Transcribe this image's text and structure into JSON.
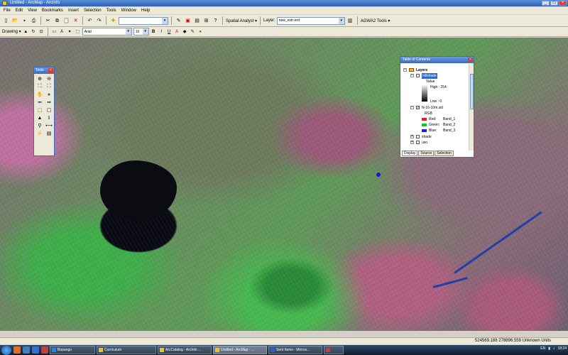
{
  "window": {
    "title": "Untitled - ArcMap - ArcInfo"
  },
  "menu": [
    "File",
    "Edit",
    "View",
    "Bookmarks",
    "Insert",
    "Selection",
    "Tools",
    "Window",
    "Help"
  ],
  "toolbar1": {
    "spatial_analyst_label": "Spatial Analyst ▾",
    "layer_label": "Layer:",
    "layer_value": "new_extr-erd",
    "agwa_label": "AGWA2 Tools ▾"
  },
  "toolbar2": {
    "drawing_label": "Drawing ▾",
    "font_name": "Arial",
    "font_size": "10",
    "bold": "B",
    "italic": "I",
    "underline": "U",
    "font_color": "A"
  },
  "tools_window": {
    "title": "Tools"
  },
  "toc": {
    "title": "Table of Contents",
    "root": "Layers",
    "layers": [
      {
        "name": "hillshade",
        "checked": false,
        "selected": true
      },
      {
        "legend_title": "Value"
      },
      {
        "high": "High : 254"
      },
      {
        "low": "Low : 0"
      },
      {
        "name": "N-16-10m.sid",
        "checked": true
      },
      {
        "legend_title": "RGB"
      },
      {
        "band_label": "Red:",
        "band": "Band_1",
        "color": "#e02020"
      },
      {
        "band_label": "Green:",
        "band": "Band_2",
        "color": "#20c020"
      },
      {
        "band_label": "Blue:",
        "band": "Band_3",
        "color": "#2020e0"
      },
      {
        "name": "shade",
        "checked": false
      },
      {
        "name": "uso",
        "checked": false
      }
    ],
    "tabs": [
      "Display",
      "Source",
      "Selection"
    ]
  },
  "statusbar": {
    "coords": "524569.188  278896.559 Unknown Units"
  },
  "taskbar": {
    "tasks": [
      {
        "label": "Bopango",
        "color": "#3080e0"
      },
      {
        "label": "Curriculum",
        "color": "#e8c040"
      },
      {
        "label": "ArcCatalog - ArcInfo ...",
        "color": "#e8c040"
      },
      {
        "label": "Untitled - ArcMap - ...",
        "color": "#e8c040",
        "active": true
      },
      {
        "label": "Sent Items - Micros...",
        "color": "#3060c0"
      },
      {
        "label": "",
        "color": "#c04040"
      }
    ],
    "lang": "EN",
    "time": "18:24"
  },
  "colors": {
    "accent": "#3a6ac0",
    "lake": "#0b0b12",
    "river": "#2040a8"
  }
}
